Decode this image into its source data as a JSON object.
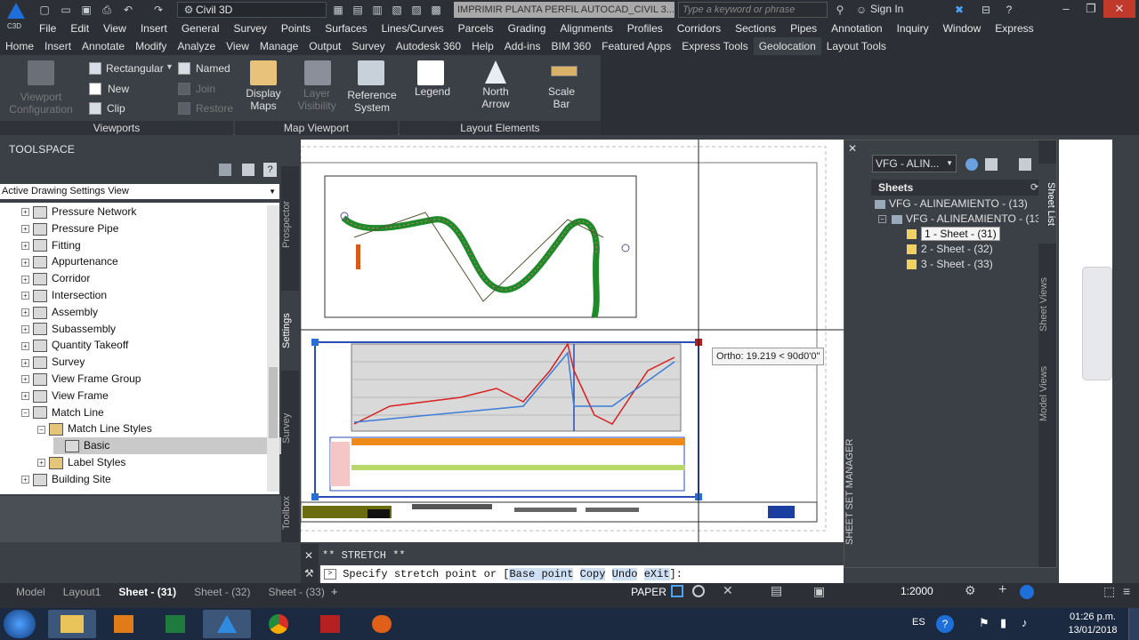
{
  "titlebar": {
    "app_logo_label": "C3D",
    "workspace": "Civil 3D",
    "document": "IMPRIMIR PLANTA PERFIL AUTOCAD_CIVIL 3...",
    "search_placeholder": "Type a keyword or phrase",
    "sign_in": "Sign In"
  },
  "menubar": [
    "File",
    "Edit",
    "View",
    "Insert",
    "General",
    "Survey",
    "Points",
    "Surfaces",
    "Lines/Curves",
    "Parcels",
    "Grading",
    "Alignments",
    "Profiles",
    "Corridors",
    "Sections",
    "Pipes",
    "Annotation",
    "Inquiry",
    "Window",
    "Express"
  ],
  "ribbon_tabs": [
    "Home",
    "Insert",
    "Annotate",
    "Modify",
    "Analyze",
    "View",
    "Manage",
    "Output",
    "Survey",
    "Autodesk 360",
    "Help",
    "Add-ins",
    "BIM 360",
    "Featured Apps",
    "Express Tools",
    "Geolocation",
    "Layout Tools"
  ],
  "ribbon": {
    "viewports": {
      "title": "Viewports",
      "viewport_config": "Viewport Configuration",
      "rectangular": "Rectangular",
      "named": "Named",
      "new": "New",
      "join": "Join",
      "clip": "Clip",
      "restore": "Restore"
    },
    "map_viewport": {
      "title": "Map Viewport",
      "display_maps": "Display Maps",
      "layer_visibility": "Layer Visibility",
      "reference_system": "Reference System"
    },
    "layout_elements": {
      "title": "Layout Elements",
      "legend": "Legend",
      "north_arrow": "North Arrow",
      "scale_bar": "Scale Bar"
    }
  },
  "toolspace": {
    "title": "TOOLSPACE",
    "view_select": "Active Drawing Settings View",
    "side_tabs": [
      "Prospector",
      "Settings",
      "Survey",
      "Toolbox"
    ],
    "tree": [
      "Pressure Network",
      "Pressure Pipe",
      "Fitting",
      "Appurtenance",
      "Corridor",
      "Intersection",
      "Assembly",
      "Subassembly",
      "Quantity Takeoff",
      "Survey",
      "View Frame Group",
      "View Frame",
      "Match Line",
      "Match Line Styles",
      "Basic",
      "Label Styles",
      "Building Site"
    ]
  },
  "drawing": {
    "tooltip": "Ortho: 19.219 < 90d0'0\""
  },
  "sheetset": {
    "combo": "VFG - ALIN...",
    "header": "Sheets",
    "root": "VFG - ALINEAMIENTO - (13)",
    "child": "VFG - ALINEAMIENTO - (13)",
    "sheets": [
      "1 - Sheet - (31)",
      "2 - Sheet - (32)",
      "3 - Sheet - (33)"
    ],
    "side_tabs": [
      "Sheet List",
      "Sheet Views",
      "Model Views"
    ],
    "vertical_title": "SHEET SET MANAGER"
  },
  "command": {
    "history": "** STRETCH **",
    "prompt": "Specify stretch point or [",
    "options": [
      "Base point",
      "Copy",
      "Undo",
      "eXit"
    ],
    "suffix": "]:"
  },
  "layout_tabs": [
    "Model",
    "Layout1",
    "Sheet - (31)",
    "Sheet - (32)",
    "Sheet - (33)"
  ],
  "status": {
    "paper": "PAPER",
    "scale": "1:2000"
  },
  "taskbar": {
    "lang": "ES",
    "time": "01:26 p.m.",
    "date": "13/01/2018"
  },
  "colors": {
    "accent": "#1e6fd9",
    "road_green": "#1f8a2a",
    "profile_red": "#d91f1f"
  }
}
